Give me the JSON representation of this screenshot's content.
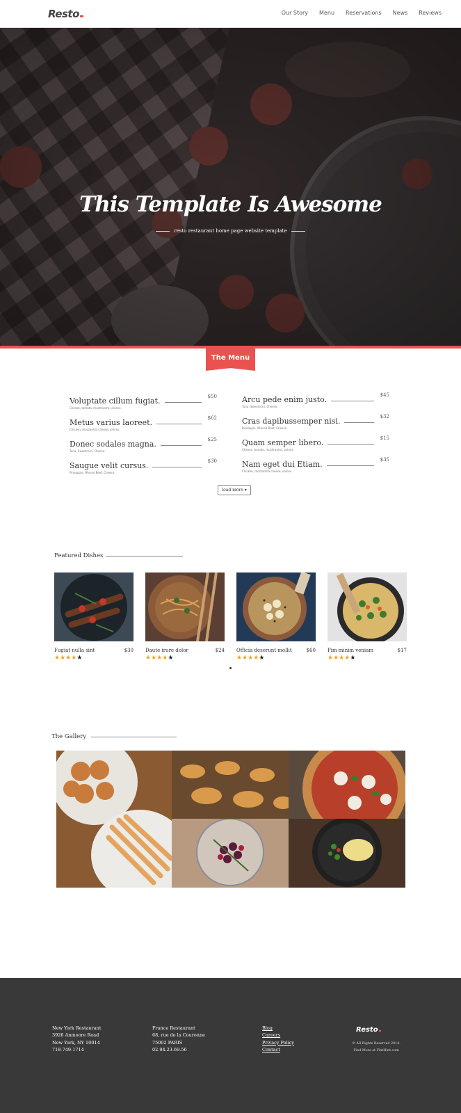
{
  "brand": {
    "name": "Resto",
    "accent": "#e9534f"
  },
  "nav": {
    "links": [
      "Our Story",
      "Menu",
      "Reservations",
      "News",
      "Reviews"
    ]
  },
  "hero": {
    "title": "This Template Is Awesome",
    "subtitle": "resto restaurant home page website template"
  },
  "menu": {
    "tab_label": "The Menu",
    "left": [
      {
        "name": "Voluptate cillum fugiat.",
        "price": "$50",
        "desc": "Cheese, tomato, mushrooms, onions."
      },
      {
        "name": "Metus varius laoreet.",
        "price": "$62",
        "desc": "Chicken, mozzarella cheese, onions."
      },
      {
        "name": "Donec sodales magna.",
        "price": "$25",
        "desc": "Tuna, Sweetcorn, Cheese."
      },
      {
        "name": "Saugue velit cursus.",
        "price": "$30",
        "desc": "Pineapple, Minced Beef, Cheese."
      }
    ],
    "right": [
      {
        "name": "Arcu pede enim justo.",
        "price": "$45",
        "desc": "Tuna, Sweetcorn, Cheese."
      },
      {
        "name": "Cras dapibussemper nisi.",
        "price": "$32",
        "desc": "Pineapple, Minced Beef, Cheese."
      },
      {
        "name": "Quam semper libero.",
        "price": "$15",
        "desc": "Cheese, tomato, mushrooms, onions."
      },
      {
        "name": "Nam eget dui Etiam.",
        "price": "$35",
        "desc": "Chicken, mozzarella cheese, onions."
      }
    ],
    "load_more": "load more"
  },
  "featured": {
    "title": "Featured Dishes",
    "dishes": [
      {
        "name": "Fugiat nulla sint",
        "price": "$30",
        "rating": 4,
        "icon": "skewers-photo"
      },
      {
        "name": "Daute irure dolor",
        "price": "$24",
        "rating": 4,
        "icon": "noodles-photo"
      },
      {
        "name": "Officia deserunt mollit",
        "price": "$60",
        "rating": 4,
        "icon": "oatmeal-photo"
      },
      {
        "name": "Pim minim veniam",
        "price": "$17",
        "rating": 4,
        "icon": "pasta-pan-photo"
      }
    ]
  },
  "gallery": {
    "title": "The Gallery"
  },
  "footer": {
    "ny": [
      "New York Restaurant",
      "3926 Anmoore Road",
      "New York, NY 10014",
      "718-749-1714"
    ],
    "fr": [
      "France Restaurant",
      "68, rue de la Couronne",
      "75002 PARIS",
      "02.94.23.69.56"
    ],
    "links": [
      "Blog",
      "Careers",
      "Privacy Policy",
      "Contact"
    ],
    "logo": "Resto",
    "copyright": "© All Rights Reserved 2014.",
    "credit": "Find More at FlatHint.com"
  }
}
